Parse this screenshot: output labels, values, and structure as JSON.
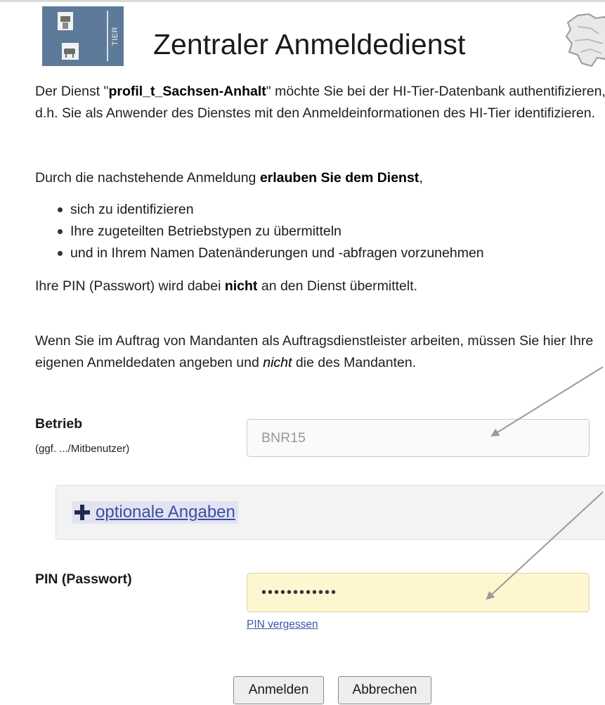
{
  "header": {
    "logo_text": "TIER",
    "title": "Zentraler Anmeldedienst",
    "logo_icon": "hi-tier-logo",
    "map_icon": "germany-map-icon"
  },
  "intro": {
    "part1": "Der Dienst \"",
    "service_name": "profil_t_Sachsen-Anhalt",
    "part2": "\" möchte Sie bei der HI-Tier-Datenbank authentifizieren, d.h. Sie als Anwender des Dienstes mit den Anmeldeinformationen des HI-Tier identifizieren."
  },
  "permission": {
    "part1": "Durch die nachstehende Anmeldung ",
    "bold": "erlauben Sie dem Dienst",
    "part2": ","
  },
  "permissions_list": [
    "sich zu identifizieren",
    "Ihre zugeteilten Betriebstypen zu übermitteln",
    "und in Ihrem Namen Datenänderungen und -abfragen vorzunehmen"
  ],
  "pin_note": {
    "part1": "Ihre PIN (Passwort) wird dabei ",
    "bold": "nicht",
    "part2": " an den Dienst übermittelt."
  },
  "mandant_note": {
    "part1": "Wenn Sie im Auftrag von Mandanten als Auftragsdienstleister arbeiten, müssen Sie hier Ihre eigenen Anmeldedaten angeben und ",
    "italic": "nicht",
    "part2": " die des Mandanten."
  },
  "form": {
    "betrieb_label": "Betrieb",
    "betrieb_hint": "(ggf. .../Mitbenutzer)",
    "betrieb_placeholder": "BNR15",
    "optional_label": "optionale Angaben",
    "pin_label": "PIN (Passwort)",
    "pin_value": "••••••••••••",
    "forgot_pin": "PIN vergessen",
    "login_button": "Anmelden",
    "cancel_button": "Abbrechen"
  },
  "colors": {
    "pin_field_bg": "#fdf6cf",
    "link": "#3a4fa0",
    "logo": "#5e7a9a"
  }
}
